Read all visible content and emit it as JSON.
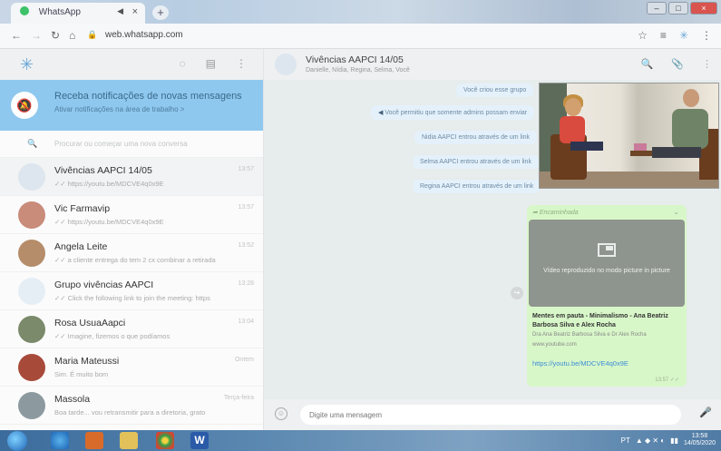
{
  "browser": {
    "tab_title": "WhatsApp",
    "tab_close": "×",
    "new_tab": "+",
    "url": "web.whatsapp.com",
    "win_min": "–",
    "win_max": "□",
    "win_close": "×"
  },
  "sidebar": {
    "notification": {
      "title": "Receba notificações de novas mensagens",
      "subtitle": "Ativar notificações na área de trabalho >"
    },
    "search_placeholder": "Procurar ou começar uma nova conversa",
    "chats": [
      {
        "name": "Vivências AAPCI 14/05",
        "last": "✓✓ https://youtu.be/MDCVE4q0x9E",
        "time": "13:57",
        "avatar_color": "#dde6ee"
      },
      {
        "name": "Vic Farmavip",
        "last": "✓✓ https://youtu.be/MDCVE4q0x9E",
        "time": "13:57",
        "avatar_color": "#c98b7a"
      },
      {
        "name": "Angela Leite",
        "last": "✓✓ a cliente entrega do tem 2 cx combinar a retirada",
        "time": "13:52",
        "avatar_color": "#b58d6a"
      },
      {
        "name": "Grupo vivências AAPCI",
        "last": "✓✓ Click the following link to join the meeting: https",
        "time": "13:28",
        "avatar_color": "#e6eef5"
      },
      {
        "name": "Rosa UsuaAapci",
        "last": "✓✓ Imagine, fizemos o que podíamos",
        "time": "13:04",
        "avatar_color": "#7a8a6a"
      },
      {
        "name": "Maria Mateussi",
        "last": "Sim. É muito bom",
        "time": "Ontem",
        "avatar_color": "#a84a3a"
      },
      {
        "name": "Massola",
        "last": "Boa tarde... vou retransmitir para a diretoria, grato",
        "time": "Terça-feira",
        "avatar_color": "#8c9aa0"
      }
    ]
  },
  "conversation": {
    "title": "Vivências AAPCI 14/05",
    "members": "Danielle, Nídia, Regina, Selma, Você",
    "system_messages": [
      "Você criou esse grupo",
      "Você permitiu que somente admins possam enviar",
      "Nidia AAPCI entrou através de um link",
      "Selma AAPCI entrou através de um link",
      "Regina AAPCI entrou através de um link"
    ],
    "forwarded_label": "Encaminhada",
    "pip_text": "Vídeo reproduzido no modo picture in picture",
    "link_title": "Mentes em pauta - Minimalismo - Ana Beatriz Barbosa Silva e Alex Rocha",
    "link_desc": "Dra Ana Beatriz Barbosa Silva e Dr Alex Rocha",
    "link_site": "www.youtube.com",
    "link_url": "https://youtu.be/MDCVE4q0x9E",
    "msg_time": "13:57 ✓✓",
    "composer_placeholder": "Digite uma mensagem"
  },
  "taskbar": {
    "lang": "PT",
    "time": "13:58",
    "date": "14/05/2020"
  },
  "icons": {
    "logo": "logo-icon",
    "status": "status-icon",
    "new_chat": "new-chat-icon",
    "menu": "menu-icon",
    "search": "search-icon",
    "attach": "attach-icon",
    "emoji": "emoji-icon",
    "mic": "mic-icon"
  }
}
